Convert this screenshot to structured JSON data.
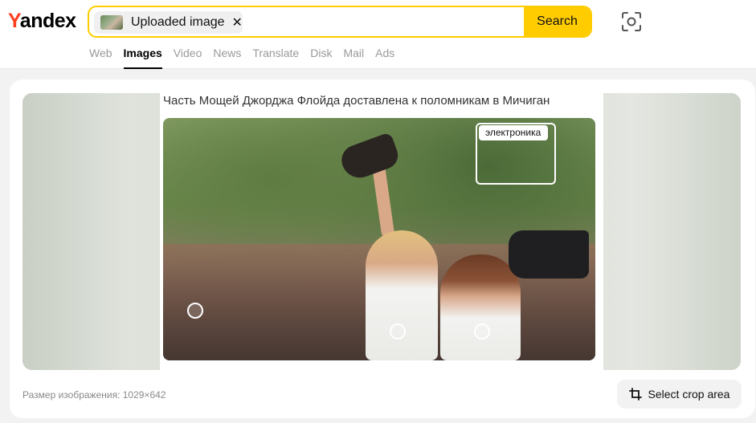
{
  "header": {
    "logo_first": "Y",
    "logo_rest": "andex",
    "search": {
      "chip_label": "Uploaded image",
      "chip_close": "✕",
      "button_label": "Search"
    },
    "tabs": [
      {
        "label": "Web",
        "active": false
      },
      {
        "label": "Images",
        "active": true
      },
      {
        "label": "Video",
        "active": false
      },
      {
        "label": "News",
        "active": false
      },
      {
        "label": "Translate",
        "active": false
      },
      {
        "label": "Disk",
        "active": false
      },
      {
        "label": "Mail",
        "active": false
      },
      {
        "label": "Ads",
        "active": false
      }
    ]
  },
  "viewer": {
    "caption": "Часть Мощей Джорджа Флойда доставлена к поломникам в Мичиган",
    "detected_object_label": "электроника",
    "image_size_text": "Размер изображения: 1029×642",
    "crop_button_label": "Select crop area"
  },
  "colors": {
    "brand_red": "#fc3f1d",
    "accent_yellow": "#ffcc00"
  },
  "icons": {
    "lens": "camera-search-icon",
    "crop": "crop-icon",
    "close": "close-icon"
  }
}
